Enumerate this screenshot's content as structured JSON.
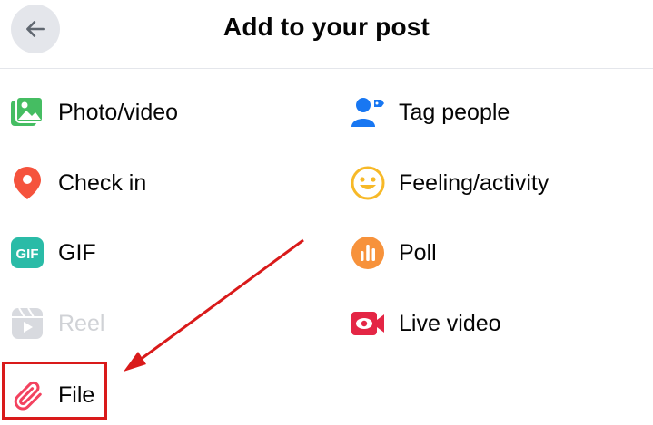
{
  "header": {
    "title": "Add to your post",
    "back_icon": "arrow-left-icon"
  },
  "options": [
    {
      "label": "Photo/video",
      "icon": "photo-video-icon",
      "color": "#45bd62"
    },
    {
      "label": "Tag people",
      "icon": "tag-people-icon",
      "color": "#1877f2"
    },
    {
      "label": "Check in",
      "icon": "location-pin-icon",
      "color": "#f5533d"
    },
    {
      "label": "Feeling/activity",
      "icon": "smiley-icon",
      "color": "#f7b928"
    },
    {
      "label": "GIF",
      "icon": "gif-icon",
      "color": "#2abba7"
    },
    {
      "label": "Poll",
      "icon": "poll-icon",
      "color": "#f7923b"
    },
    {
      "label": "Reel",
      "icon": "reel-icon",
      "color": "#d8dadf",
      "disabled": true
    },
    {
      "label": "Live video",
      "icon": "live-video-icon",
      "color": "#e42645"
    },
    {
      "label": "File",
      "icon": "paperclip-icon",
      "color": "#f3425f"
    }
  ],
  "annotation": {
    "color": "#d91a1a"
  }
}
